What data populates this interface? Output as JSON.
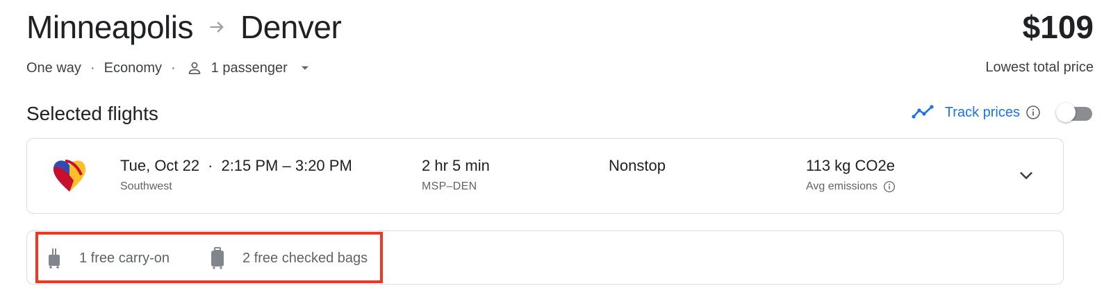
{
  "route": {
    "origin": "Minneapolis",
    "destination": "Denver",
    "arrow_icon": "arrow-right-icon"
  },
  "price": {
    "amount": "$109",
    "label": "Lowest total price"
  },
  "trip": {
    "type": "One way",
    "separator": "·",
    "cabin": "Economy",
    "passengers": "1 passenger"
  },
  "selected_flights": {
    "title": "Selected flights"
  },
  "track_prices": {
    "label": "Track prices",
    "enabled": false
  },
  "flight": {
    "date": "Tue, Oct 22",
    "separator": "·",
    "times": "2:15 PM – 3:20 PM",
    "airline": "Southwest",
    "duration": "2 hr 5 min",
    "airports": "MSP–DEN",
    "stops": "Nonstop",
    "emissions": "113 kg CO2e",
    "emissions_label": "Avg emissions"
  },
  "baggage": {
    "carry_on": "1 free carry-on",
    "checked": "2 free checked bags"
  },
  "colors": {
    "accent_blue": "#1a73e8",
    "highlight_red": "#f3361f",
    "border": "#dadce0",
    "southwest_blue": "#304cb2",
    "southwest_red": "#c8102e",
    "southwest_yellow": "#ffbf27"
  }
}
